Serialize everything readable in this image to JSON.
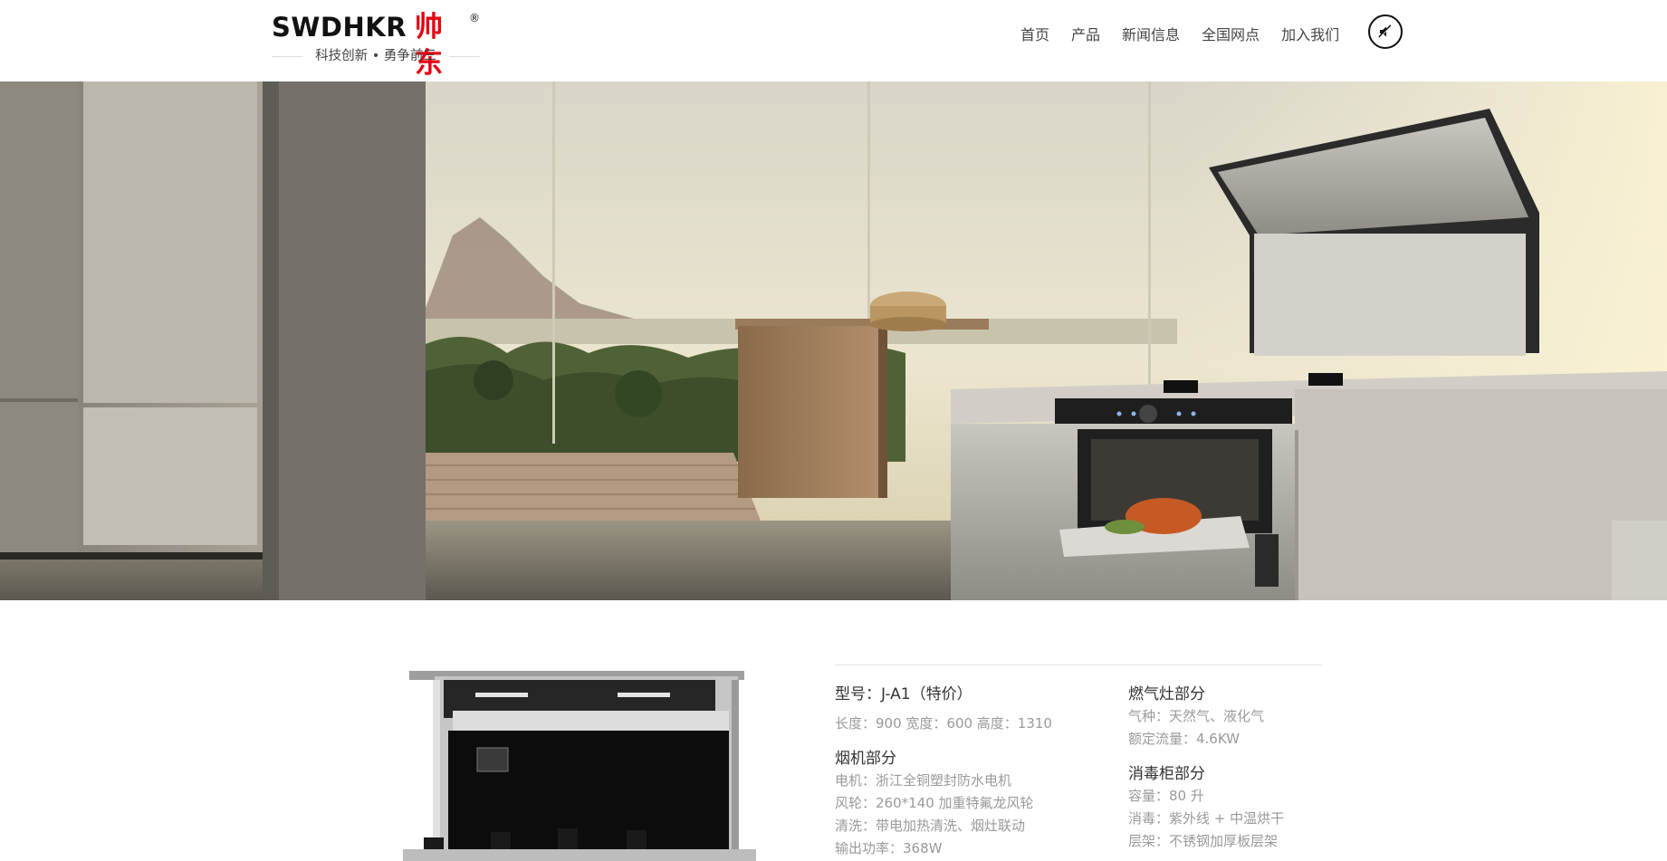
{
  "brand": {
    "name_en": "SWDHKR",
    "name_cn": "帅东",
    "registered_mark": "®",
    "slogan": "科技创新 • 勇争前三",
    "accent_color": "#e60012"
  },
  "nav": {
    "items": [
      {
        "label": "首页"
      },
      {
        "label": "产品"
      },
      {
        "label": "新闻信息"
      },
      {
        "label": "全国网点"
      },
      {
        "label": "加入我们"
      }
    ],
    "music_toggle_icon": "muted-speaker-icon"
  },
  "hero": {
    "image": "integrated-stove-kitchen-banner"
  },
  "product": {
    "image": "integrated-stove-product-photo",
    "model": "型号：J-A1（特价）",
    "dimensions": "长度：900   宽度：600   高度：1310",
    "sections": [
      {
        "title": "烟机部分",
        "items": [
          "电机：浙江全铜塑封防水电机",
          "风轮：260*140 加重特氟龙风轮",
          "清洗：带电加热清洗、烟灶联动",
          "输出功率：368W"
        ]
      },
      {
        "title": "燃气灶部分",
        "items": [
          "气种：天然气、液化气",
          "额定流量：4.6KW"
        ]
      },
      {
        "title": "消毒柜部分",
        "items": [
          "容量：80 升",
          "消毒：紫外线 + 中温烘干",
          "层架：不锈钢加厚板层架"
        ]
      }
    ]
  }
}
